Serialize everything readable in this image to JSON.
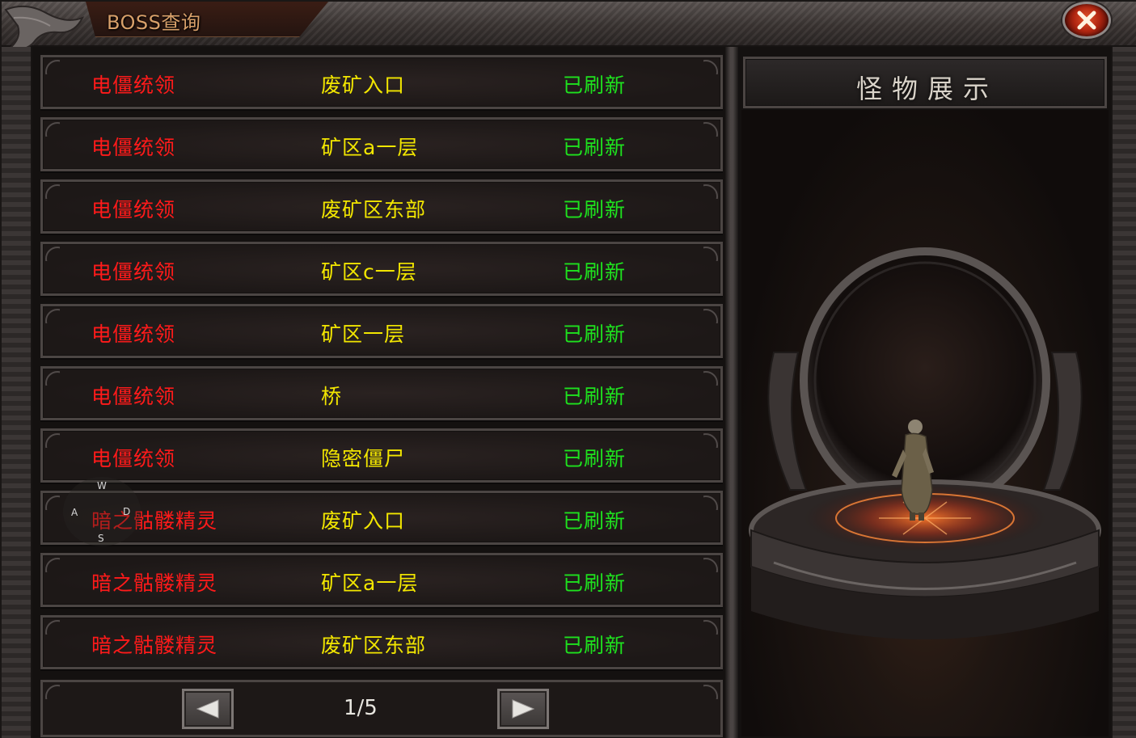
{
  "window": {
    "title": "BOSS查询"
  },
  "close": {
    "icon": "close-icon"
  },
  "boss_list": {
    "columns": [
      "name",
      "map",
      "status"
    ],
    "rows": [
      {
        "name": "电僵统领",
        "map": "废矿入口",
        "status": "已刷新"
      },
      {
        "name": "电僵统领",
        "map": "矿区a一层",
        "status": "已刷新"
      },
      {
        "name": "电僵统领",
        "map": "废矿区东部",
        "status": "已刷新"
      },
      {
        "name": "电僵统领",
        "map": "矿区c一层",
        "status": "已刷新"
      },
      {
        "name": "电僵统领",
        "map": "矿区一层",
        "status": "已刷新"
      },
      {
        "name": "电僵统领",
        "map": "桥",
        "status": "已刷新"
      },
      {
        "name": "电僵统领",
        "map": "隐密僵尸",
        "status": "已刷新"
      },
      {
        "name": "暗之骷髅精灵",
        "map": "废矿入口",
        "status": "已刷新"
      },
      {
        "name": "暗之骷髅精灵",
        "map": "矿区a一层",
        "status": "已刷新"
      },
      {
        "name": "暗之骷髅精灵",
        "map": "废矿区东部",
        "status": "已刷新"
      }
    ],
    "colors": {
      "name": "#ff1a1a",
      "map": "#f2e600",
      "status": "#1ee21e"
    }
  },
  "pager": {
    "page": "1/5",
    "prev_icon": "arrow-left-icon",
    "next_icon": "arrow-right-icon"
  },
  "joystick": {
    "up": "W",
    "left": "A",
    "right": "D",
    "down": "S"
  },
  "preview": {
    "title": "怪物展示"
  }
}
